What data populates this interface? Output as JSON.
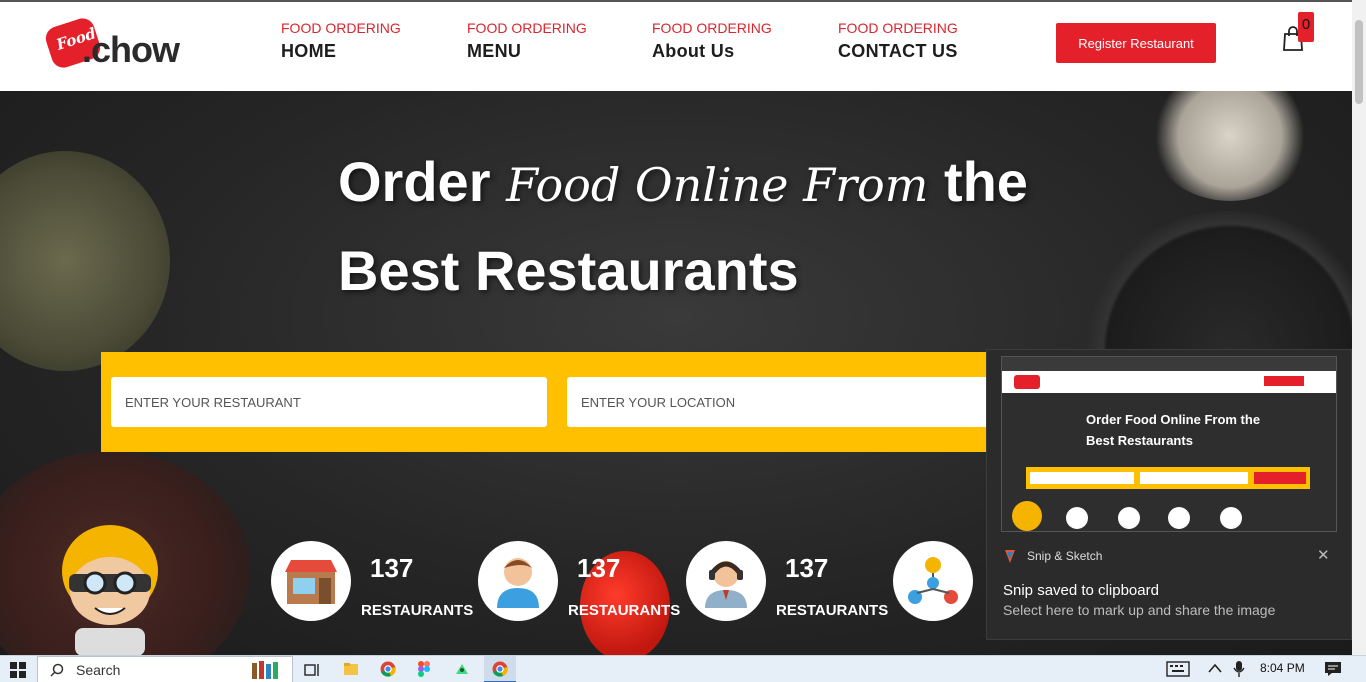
{
  "header": {
    "logo_badge": "Food",
    "logo_text": ".chow",
    "nav": [
      {
        "sub": "FOOD ORDERING",
        "label": "HOME"
      },
      {
        "sub": "FOOD ORDERING",
        "label": "MENU"
      },
      {
        "sub": "FOOD ORDERING",
        "label": "About Us"
      },
      {
        "sub": "FOOD ORDERING",
        "label": "CONTACT US"
      }
    ],
    "register_label": "Register Restaurant",
    "cart_count": "0"
  },
  "hero": {
    "line1_start": "Order",
    "line1_script": "Food Online From",
    "line1_end": "the",
    "line2": "Best Restaurants",
    "restaurant_placeholder": "ENTER YOUR RESTAURANT",
    "location_placeholder": "ENTER YOUR LOCATION",
    "stats": [
      {
        "number": "137",
        "label": "RESTAURANTS",
        "icon": "storefront-icon"
      },
      {
        "number": "137",
        "label": "RESTAURANTS",
        "icon": "person-icon"
      },
      {
        "number": "137",
        "label": "RESTAURANTS",
        "icon": "support-agent-icon"
      },
      {
        "number": "",
        "label": "",
        "icon": "network-icon"
      }
    ]
  },
  "toast": {
    "app_name": "Snip & Sketch",
    "title": "Snip saved to clipboard",
    "message": "Select here to mark up and share the image",
    "close": "✕",
    "thumb_line1": "Order Food Online From the",
    "thumb_line2": "Best Restaurants"
  },
  "taskbar": {
    "search_label": "Search",
    "time": "8:04 PM"
  },
  "colors": {
    "brand_red": "#e4202b",
    "search_yellow": "#ffc000"
  }
}
